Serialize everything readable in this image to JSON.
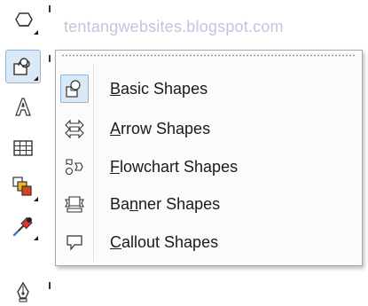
{
  "watermark": "tentangwebsites.blogspot.com",
  "toolbox": {
    "tools": [
      {
        "name": "polygon-tool",
        "icon": "hexagon-icon"
      },
      {
        "name": "basic-shapes-tool",
        "icon": "basic-shapes-icon",
        "active": true
      },
      {
        "name": "text-tool",
        "icon": "text-a-icon"
      },
      {
        "name": "table-tool",
        "icon": "table-icon"
      },
      {
        "name": "interactive-fill-tool",
        "icon": "fill-icon"
      },
      {
        "name": "eyedropper-tool",
        "icon": "eyedropper-icon"
      },
      {
        "name": "outline-pen-tool",
        "icon": "pen-nib-icon"
      }
    ]
  },
  "menu": {
    "items": [
      {
        "label_underlined": "B",
        "label_rest": "asic Shapes",
        "icon": "basic-shapes-icon",
        "checked": true
      },
      {
        "label_underlined": "A",
        "label_rest": "rrow Shapes",
        "icon": "arrow-shapes-icon",
        "checked": false
      },
      {
        "label_underlined": "F",
        "label_rest": "lowchart Shapes",
        "icon": "flowchart-shapes-icon",
        "checked": false
      },
      {
        "label_prefix": "Ba",
        "label_underlined": "n",
        "label_rest": "ner Shapes",
        "icon": "banner-shapes-icon",
        "checked": false
      },
      {
        "label_underlined": "C",
        "label_rest": "allout Shapes",
        "icon": "callout-shapes-icon",
        "checked": false
      }
    ]
  },
  "colors": {
    "checked_bg": "#dbe8f6",
    "checked_border": "#8fb3dc",
    "watermark": "#c9c2da",
    "menu_bg": "#fbfbfb"
  }
}
